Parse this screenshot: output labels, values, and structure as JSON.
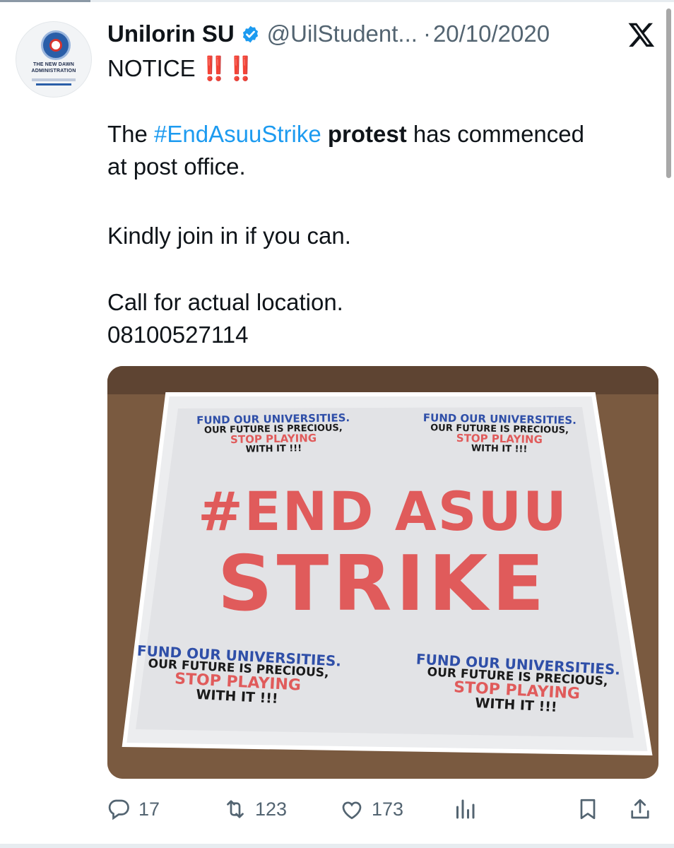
{
  "tweet": {
    "display_name": "Unilorin SU",
    "handle": "@UilStudent...",
    "separator": "·",
    "date": "20/10/2020",
    "avatar_text": [
      "THE NEW DAWN",
      "ADMINISTRATION"
    ],
    "text": {
      "notice": "NOTICE",
      "notice_marks": "‼️‼️",
      "line1_prefix": "The ",
      "hashtag": "#EndAsuuStrike",
      "bold_word": "protest",
      "line1_suffix": " has commenced",
      "line2": "at post office.",
      "line3": "Kindly join in if you can.",
      "line4": "Call for actual location.",
      "line5": "08100527114"
    }
  },
  "media": {
    "banner_main": [
      "#END ASUU",
      "STRIKE"
    ],
    "slogan": [
      "FUND OUR UNIVERSITIES.",
      "OUR FUTURE IS PRECIOUS,",
      "STOP PLAYING",
      "WITH IT !!!"
    ]
  },
  "actions": {
    "replies": "17",
    "reposts": "123",
    "likes": "173"
  },
  "colors": {
    "accent": "#1d9bf0",
    "muted": "#536471",
    "banner_red": "#e05b5b",
    "banner_blue": "#2f4fa8"
  },
  "icons": [
    "verified-badge-icon",
    "x-logo-icon",
    "reply-icon",
    "repost-icon",
    "like-icon",
    "views-icon",
    "bookmark-icon",
    "share-icon"
  ]
}
